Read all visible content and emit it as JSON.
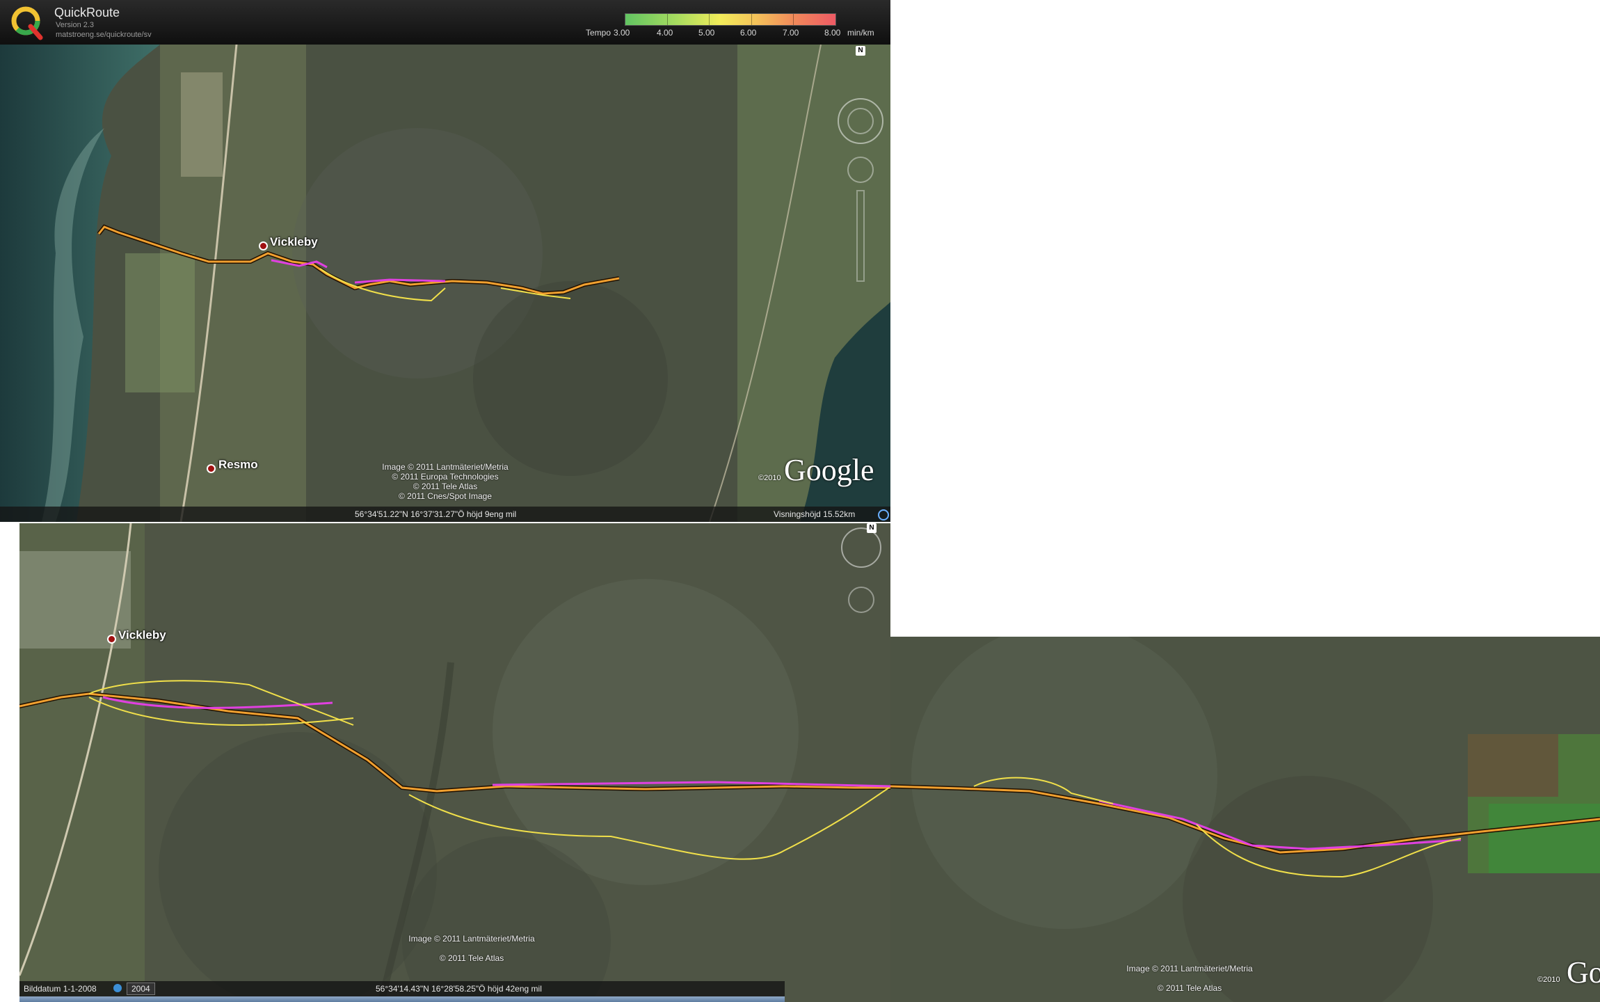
{
  "header": {
    "app_title": "QuickRoute",
    "version": "Version 2.3",
    "url": "matstroeng.se/quickroute/sv",
    "scale_prefix": "Tempo",
    "scale_ticks": [
      "3.00",
      "4.00",
      "5.00",
      "6.00",
      "7.00",
      "8.00"
    ],
    "scale_unit": "min/km"
  },
  "map_top": {
    "places": [
      "Vickleby",
      "Resmo"
    ],
    "attribution": [
      "Image © 2011 Lantmäteriet/Metria",
      "© 2011 Europa Technologies",
      "© 2011 Tele Atlas",
      "© 2011 Cnes/Spot Image"
    ],
    "year": "©2010",
    "brand": "Google",
    "status_coords": "56°34'51.22\"N   16°37'31.27\"Ö  höjd     9eng  mil",
    "status_view": "Visningshöjd     15.52km",
    "north_label": "N"
  },
  "map_bottom": {
    "places": [
      "Vickleby"
    ],
    "attribution_left": [
      "Image © 2011 Lantmäteriet/Metria",
      "© 2011 Tele Atlas"
    ],
    "attribution_right": [
      "Image © 2011 Lantmäteriet/Metria",
      "© 2011 Tele Atlas"
    ],
    "year": "©2010",
    "brand": "Go",
    "status_date": "Bilddatum   1-1-2008",
    "status_year": "2004",
    "status_coords": "56°34'14.43\"N   16°28'58.25\"Ö  höjd     42eng  mil",
    "north_label": "N"
  },
  "colors": {
    "route_slow": "#f1e04a",
    "route_mid": "#f0a030",
    "route_fast": "#e040e0",
    "route_outline": "#201000"
  }
}
